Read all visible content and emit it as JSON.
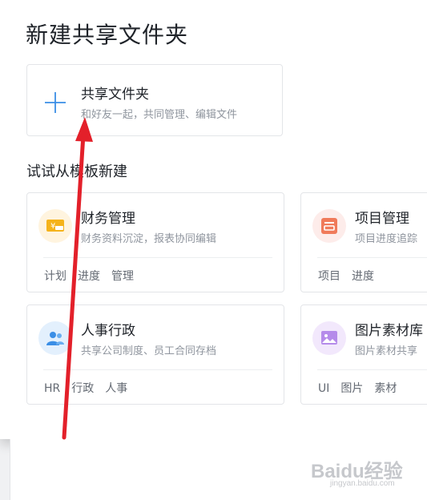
{
  "dialog": {
    "title": "新建共享文件夹"
  },
  "new_folder": {
    "title": "共享文件夹",
    "description": "和好友一起，共同管理、编辑文件",
    "icon": "plus-icon"
  },
  "templates_section": {
    "title": "试试从模板新建",
    "cards": [
      {
        "name": "财务管理",
        "description": "财务资料沉淀，报表协同编辑",
        "tags": [
          "计划",
          "进度",
          "管理"
        ],
        "icon": "finance-icon",
        "icon_bg": "#fff4df",
        "icon_color": "#f5a623"
      },
      {
        "name": "项目管理",
        "description": "项目进度追踪",
        "tags": [
          "项目",
          "进度"
        ],
        "icon": "project-icon",
        "icon_bg": "#fdecea",
        "icon_color": "#f07a5a"
      },
      {
        "name": "人事行政",
        "description": "共享公司制度、员工合同存档",
        "tags": [
          "HR",
          "行政",
          "人事"
        ],
        "icon": "people-icon",
        "icon_bg": "#e3f0fd",
        "icon_color": "#3a8ee6"
      },
      {
        "name": "图片素材库",
        "description": "图片素材共享",
        "tags": [
          "UI",
          "图片",
          "素材"
        ],
        "icon": "image-icon",
        "icon_bg": "#f2e8fc",
        "icon_color": "#9b6bdf"
      }
    ]
  },
  "watermark": {
    "brand": "Baidu经验",
    "url": "jingyan.baidu.com"
  },
  "colors": {
    "accent": "#3a8ee6",
    "arrow": "#e3202a"
  }
}
